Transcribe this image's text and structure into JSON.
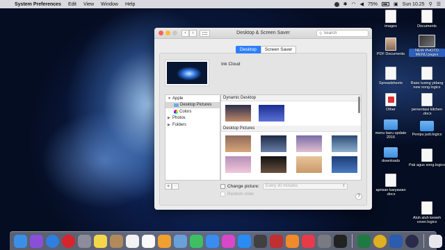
{
  "menubar": {
    "app_name": "System Preferences",
    "items": [
      "Edit",
      "View",
      "Window",
      "Help"
    ],
    "battery": "75%",
    "clock": "Sun 10.25"
  },
  "window": {
    "title": "Desktop & Screen Saver",
    "search_placeholder": "Search",
    "tabs": [
      {
        "label": "Desktop",
        "active": true
      },
      {
        "label": "Screen Saver",
        "active": false
      }
    ],
    "current_picture_name": "Ink Cloud",
    "sidebar": {
      "apple_group": "Apple",
      "desktop_pictures": "Desktop Pictures",
      "colors": "Colors",
      "photos": "Photos",
      "folders": "Folders"
    },
    "sections": {
      "dynamic": "Dynamic Desktop",
      "pictures": "Desktop Pictures"
    },
    "dynamic_thumbnails": [
      {
        "name": "mojave-dynamic",
        "color_a": "#2a2f48",
        "color_b": "#c0886a"
      },
      {
        "name": "solar-gradients",
        "color_a": "#1b2d8f",
        "color_b": "#5a72d8"
      }
    ],
    "picture_thumbnails": [
      {
        "name": "mojave-day",
        "color_a": "#8d6a5a",
        "color_b": "#d9a67a"
      },
      {
        "name": "mojave-night",
        "color_a": "#1e2a44",
        "color_b": "#6a7fa8"
      },
      {
        "name": "purple-hills",
        "color_a": "#7a6ca8",
        "color_b": "#e0c0d0"
      },
      {
        "name": "blue-lake",
        "color_a": "#2c4a74",
        "color_b": "#8fb0d0"
      },
      {
        "name": "pink-lake",
        "color_a": "#b78fb8",
        "color_b": "#f0c8d8"
      },
      {
        "name": "desert-rocks",
        "color_a": "#121212",
        "color_b": "#6a5040"
      },
      {
        "name": "dunes",
        "color_a": "#e8c49a",
        "color_b": "#c99a6a"
      },
      {
        "name": "blue-dunes",
        "color_a": "#1c3c78",
        "color_b": "#4a7ac0"
      }
    ],
    "change_picture_label": "Change picture:",
    "change_interval": "Every 30 minutes",
    "random_order_label": "Random order",
    "add_label": "+",
    "remove_label": "−",
    "help_label": "?"
  },
  "desktop_icons": [
    {
      "label": "images",
      "kind": "doc"
    },
    {
      "label": "Documents",
      "kind": "doc"
    },
    {
      "label": "PDF Documents",
      "kind": "photo"
    },
    {
      "label": "NEW PHOTO MENU.pages",
      "kind": "thumbimg"
    },
    {
      "label": "Spreadsheets",
      "kind": "doc"
    },
    {
      "label": "Rase tusing yidang new song.logicx",
      "kind": "doc"
    },
    {
      "label": "Other",
      "kind": "pdf"
    },
    {
      "label": "persentasi kitchen .docx",
      "kind": "doc"
    },
    {
      "label": "menu baru update 2016",
      "kind": "folder"
    },
    {
      "label": "Penipu judi.logicx",
      "kind": "folder"
    },
    {
      "label": "downloads",
      "kind": "folder"
    },
    {
      "label": "Pak agus song.logicx",
      "kind": "doc"
    },
    {
      "label": "aprisan karyawan .docx",
      "kind": "doc"
    },
    {
      "label": "Aluh aluh keweh cover.logicx",
      "kind": "doc"
    }
  ],
  "dock": {
    "apps": [
      {
        "name": "finder",
        "color": "#3b8fe6"
      },
      {
        "name": "siri",
        "color": "#8a4fd8"
      },
      {
        "name": "safari",
        "color": "#2f7fe0"
      },
      {
        "name": "opera",
        "color": "#d8242c"
      },
      {
        "name": "launchpad",
        "color": "#8c8c9a"
      },
      {
        "name": "notes",
        "color": "#f3d64a"
      },
      {
        "name": "contacts",
        "color": "#b08a5a"
      },
      {
        "name": "calendar",
        "color": "#f2f2f2"
      },
      {
        "name": "reminders",
        "color": "#fafafa"
      },
      {
        "name": "photos",
        "color": "#f0a030"
      },
      {
        "name": "preview",
        "color": "#6aa0d8"
      },
      {
        "name": "facetime",
        "color": "#3cc060"
      },
      {
        "name": "messages",
        "color": "#3a8cf0"
      },
      {
        "name": "itunes",
        "color": "#d848c8"
      },
      {
        "name": "app-store",
        "color": "#2a8cf2"
      },
      {
        "name": "logic",
        "color": "#404040"
      },
      {
        "name": "photo-booth",
        "color": "#c03030"
      },
      {
        "name": "ibooks",
        "color": "#f08a2a"
      },
      {
        "name": "news",
        "color": "#e83a4a"
      },
      {
        "name": "system-preferences",
        "color": "#7a7a82"
      },
      {
        "name": "activity-monitor",
        "color": "#222222"
      },
      {
        "name": "excel",
        "color": "#1e7a42"
      },
      {
        "name": "chrome",
        "color": "#e0b020"
      },
      {
        "name": "word",
        "color": "#2a5cb0"
      },
      {
        "name": "osx-app",
        "color": "#2a2a4a"
      },
      {
        "name": "downloads-stack",
        "color": "#e8e8ec"
      },
      {
        "name": "trash",
        "color": "#c8ccd4"
      }
    ]
  }
}
